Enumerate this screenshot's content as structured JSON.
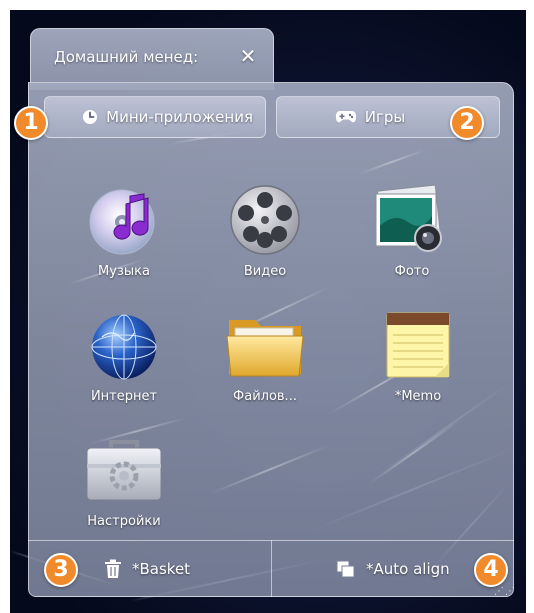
{
  "window": {
    "tab_title": "Домашний менед:",
    "close_glyph": "✕"
  },
  "top_buttons": {
    "widgets_label": "Мини-приложения",
    "widgets_icon": "clock-icon",
    "games_label": "Игры",
    "games_icon": "gamepad-icon"
  },
  "badges": [
    "1",
    "2",
    "3",
    "4"
  ],
  "apps": [
    {
      "label": "Музыка",
      "icon": "music-cd-icon"
    },
    {
      "label": "Видео",
      "icon": "film-reel-icon"
    },
    {
      "label": "Фото",
      "icon": "photo-camera-icon"
    },
    {
      "label": "Интернет",
      "icon": "globe-icon"
    },
    {
      "label": "Файлов...",
      "icon": "folder-icon"
    },
    {
      "label": "*Memo",
      "icon": "notepad-icon"
    },
    {
      "label": "Настройки",
      "icon": "settings-toolbox-icon"
    }
  ],
  "bottom_bar": {
    "basket_label": "*Basket",
    "basket_icon": "trash-icon",
    "align_label": "*Auto align",
    "align_icon": "stacked-windows-icon"
  },
  "colors": {
    "badge": "#f08a2a",
    "panel": "#8e96ae",
    "wallpaper": "#0d1430"
  }
}
